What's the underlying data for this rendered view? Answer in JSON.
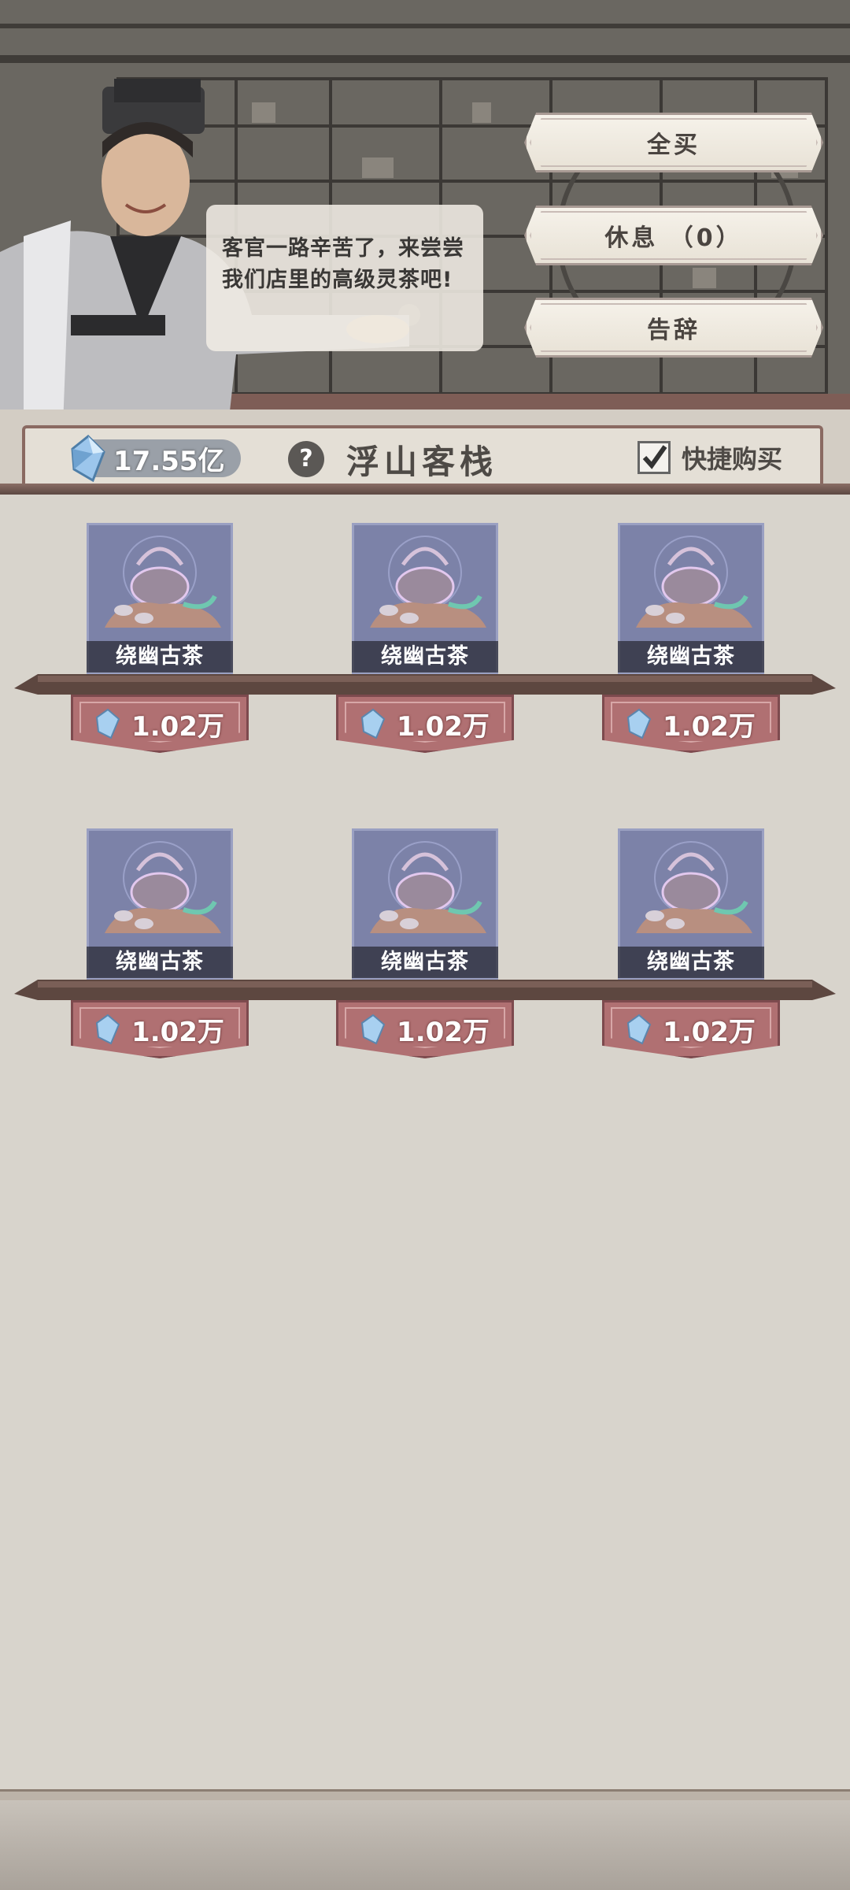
{
  "npc": {
    "dialog": "客官一路辛苦了，来尝尝我们店里的高级灵茶吧!"
  },
  "actions": {
    "buy_all": "全买",
    "rest": "休息 （0）",
    "leave": "告辞"
  },
  "header": {
    "currency_amount": "17.55亿",
    "help_symbol": "?",
    "shop_name": "浮山客栈",
    "quick_buy_label": "快捷购买",
    "quick_buy_checked": true
  },
  "items": [
    {
      "name": "绕幽古茶",
      "price": "1.02万"
    },
    {
      "name": "绕幽古茶",
      "price": "1.02万"
    },
    {
      "name": "绕幽古茶",
      "price": "1.02万"
    },
    {
      "name": "绕幽古茶",
      "price": "1.02万"
    },
    {
      "name": "绕幽古茶",
      "price": "1.02万"
    },
    {
      "name": "绕幽古茶",
      "price": "1.02万"
    }
  ],
  "icons": {
    "currency": "spirit-stone-icon",
    "item": "tea-set-icon",
    "help": "help-icon",
    "checkbox": "checkmark-icon"
  },
  "colors": {
    "price_tag": "#b07072",
    "item_card": "#7c82a8",
    "panel_bg": "#d8d4cc"
  }
}
